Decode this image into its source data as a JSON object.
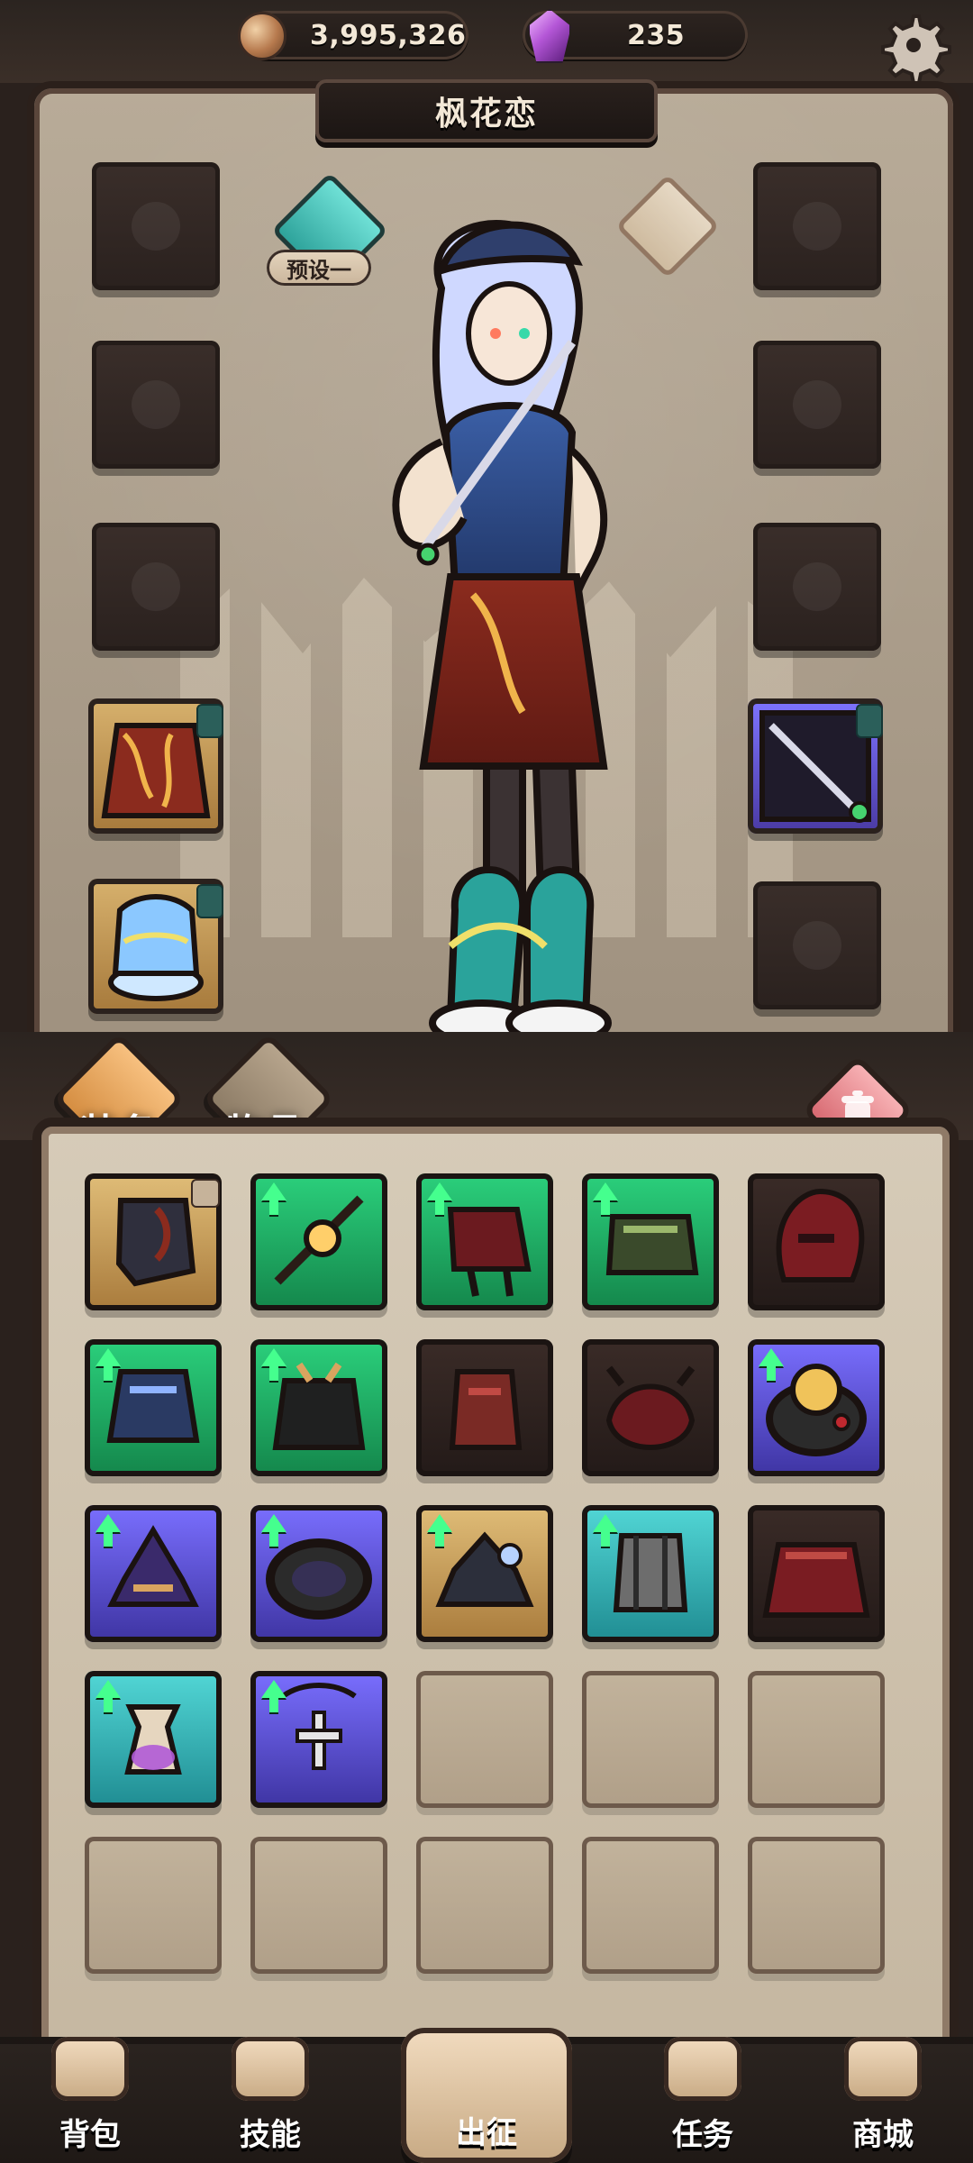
{
  "hud": {
    "gold_value": "3,995,326",
    "gem_value": "235"
  },
  "character": {
    "name": "枫花恋"
  },
  "preset": {
    "label": "预设一"
  },
  "tabs": {
    "equipment": "装备",
    "items": "物品"
  },
  "inventory": {
    "rows": [
      [
        "gold-lock",
        "green-up",
        "green-up",
        "green-up",
        "dark"
      ],
      [
        "green-up",
        "green-up",
        "dark",
        "dark",
        "purple-up"
      ],
      [
        "purple-up",
        "purple-up",
        "gold-up",
        "teal-up",
        "dark"
      ],
      [
        "teal-up",
        "purple-up",
        "empty",
        "empty",
        "empty"
      ],
      [
        "empty",
        "empty",
        "empty",
        "empty",
        "empty"
      ]
    ]
  },
  "bottom_nav": {
    "bag": "背包",
    "skills": "技能",
    "expedition": "出征",
    "quests": "任务",
    "shop": "商城"
  },
  "colors": {
    "up_arrow": "#45ff8e",
    "gold_rarity": "#d7b16d",
    "purple_rarity": "#6d5cff",
    "green_rarity": "#22c173"
  }
}
